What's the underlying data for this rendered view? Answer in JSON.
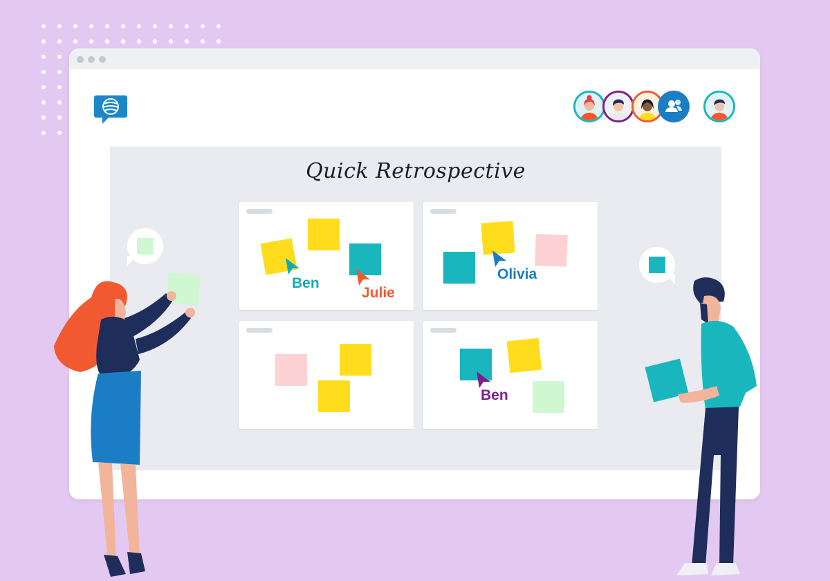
{
  "board": {
    "title": "Quick Retrospective"
  },
  "cursors": [
    {
      "name": "Ben",
      "color": "#16a9b5"
    },
    {
      "name": "Julie",
      "color": "#f15a31"
    },
    {
      "name": "Olivia",
      "color": "#1b7ec4"
    },
    {
      "name": "Ben",
      "color": "#7d1f8b"
    }
  ],
  "colors": {
    "background": "#e3c9f1",
    "note_yellow": "#ffdd1d",
    "note_teal": "#19b7bd",
    "note_pink": "#fdd2d4",
    "note_green": "#cff8d2",
    "logo_blue": "#1b87c9"
  },
  "icons": {
    "logo": "chat-bubble-logo-icon",
    "participants": "people-icon"
  },
  "window_controls": [
    "close",
    "minimize",
    "maximize"
  ],
  "avatars": [
    "user-red-hair",
    "user-dark-hair",
    "user-orange-border",
    "participants-button",
    "current-user"
  ]
}
